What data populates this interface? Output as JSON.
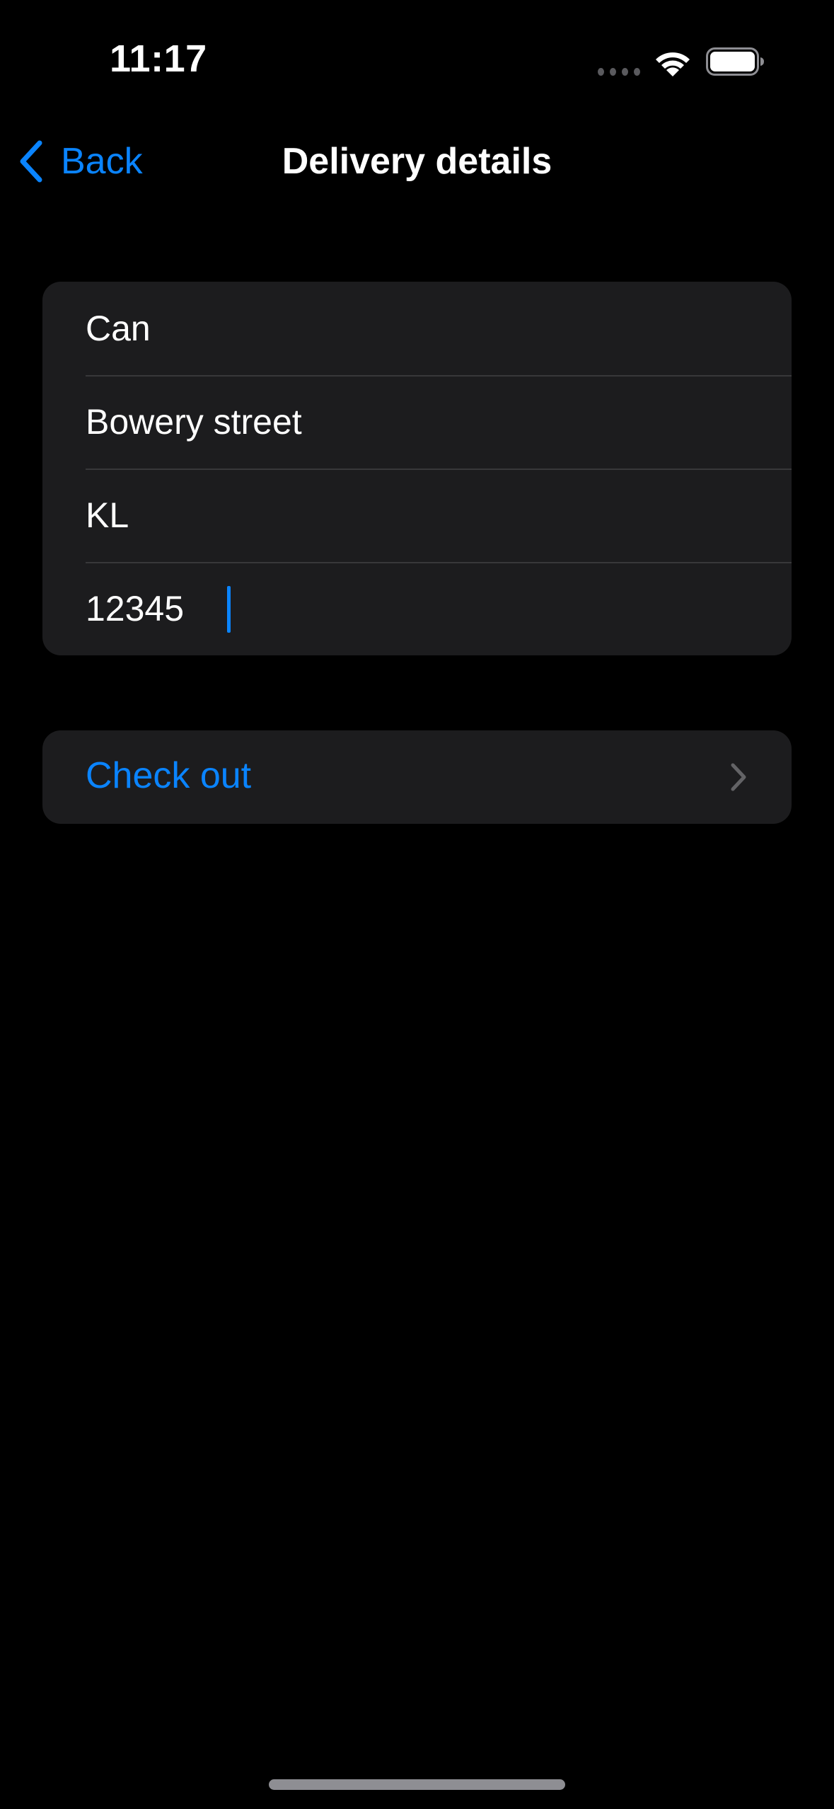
{
  "status_bar": {
    "time": "11:17",
    "icons": [
      "signal-dots-icon",
      "wifi-icon",
      "battery-icon"
    ]
  },
  "nav": {
    "back_label": "Back",
    "back_icon": "chevron-left-icon",
    "title": "Delivery details"
  },
  "form": {
    "fields": [
      {
        "name": "name",
        "value": "Can"
      },
      {
        "name": "street",
        "value": "Bowery street"
      },
      {
        "name": "city",
        "value": "KL"
      },
      {
        "name": "postal-code",
        "value": "12345",
        "focused": true
      }
    ]
  },
  "actions": {
    "checkout_label": "Check out",
    "checkout_icon": "chevron-right-icon"
  },
  "colors": {
    "background": "#000000",
    "grouped_background": "#1c1c1e",
    "separator": "#38383a",
    "accent": "#0a84ff",
    "chevron_gray": "#636366",
    "home_indicator": "#8e8e93"
  }
}
